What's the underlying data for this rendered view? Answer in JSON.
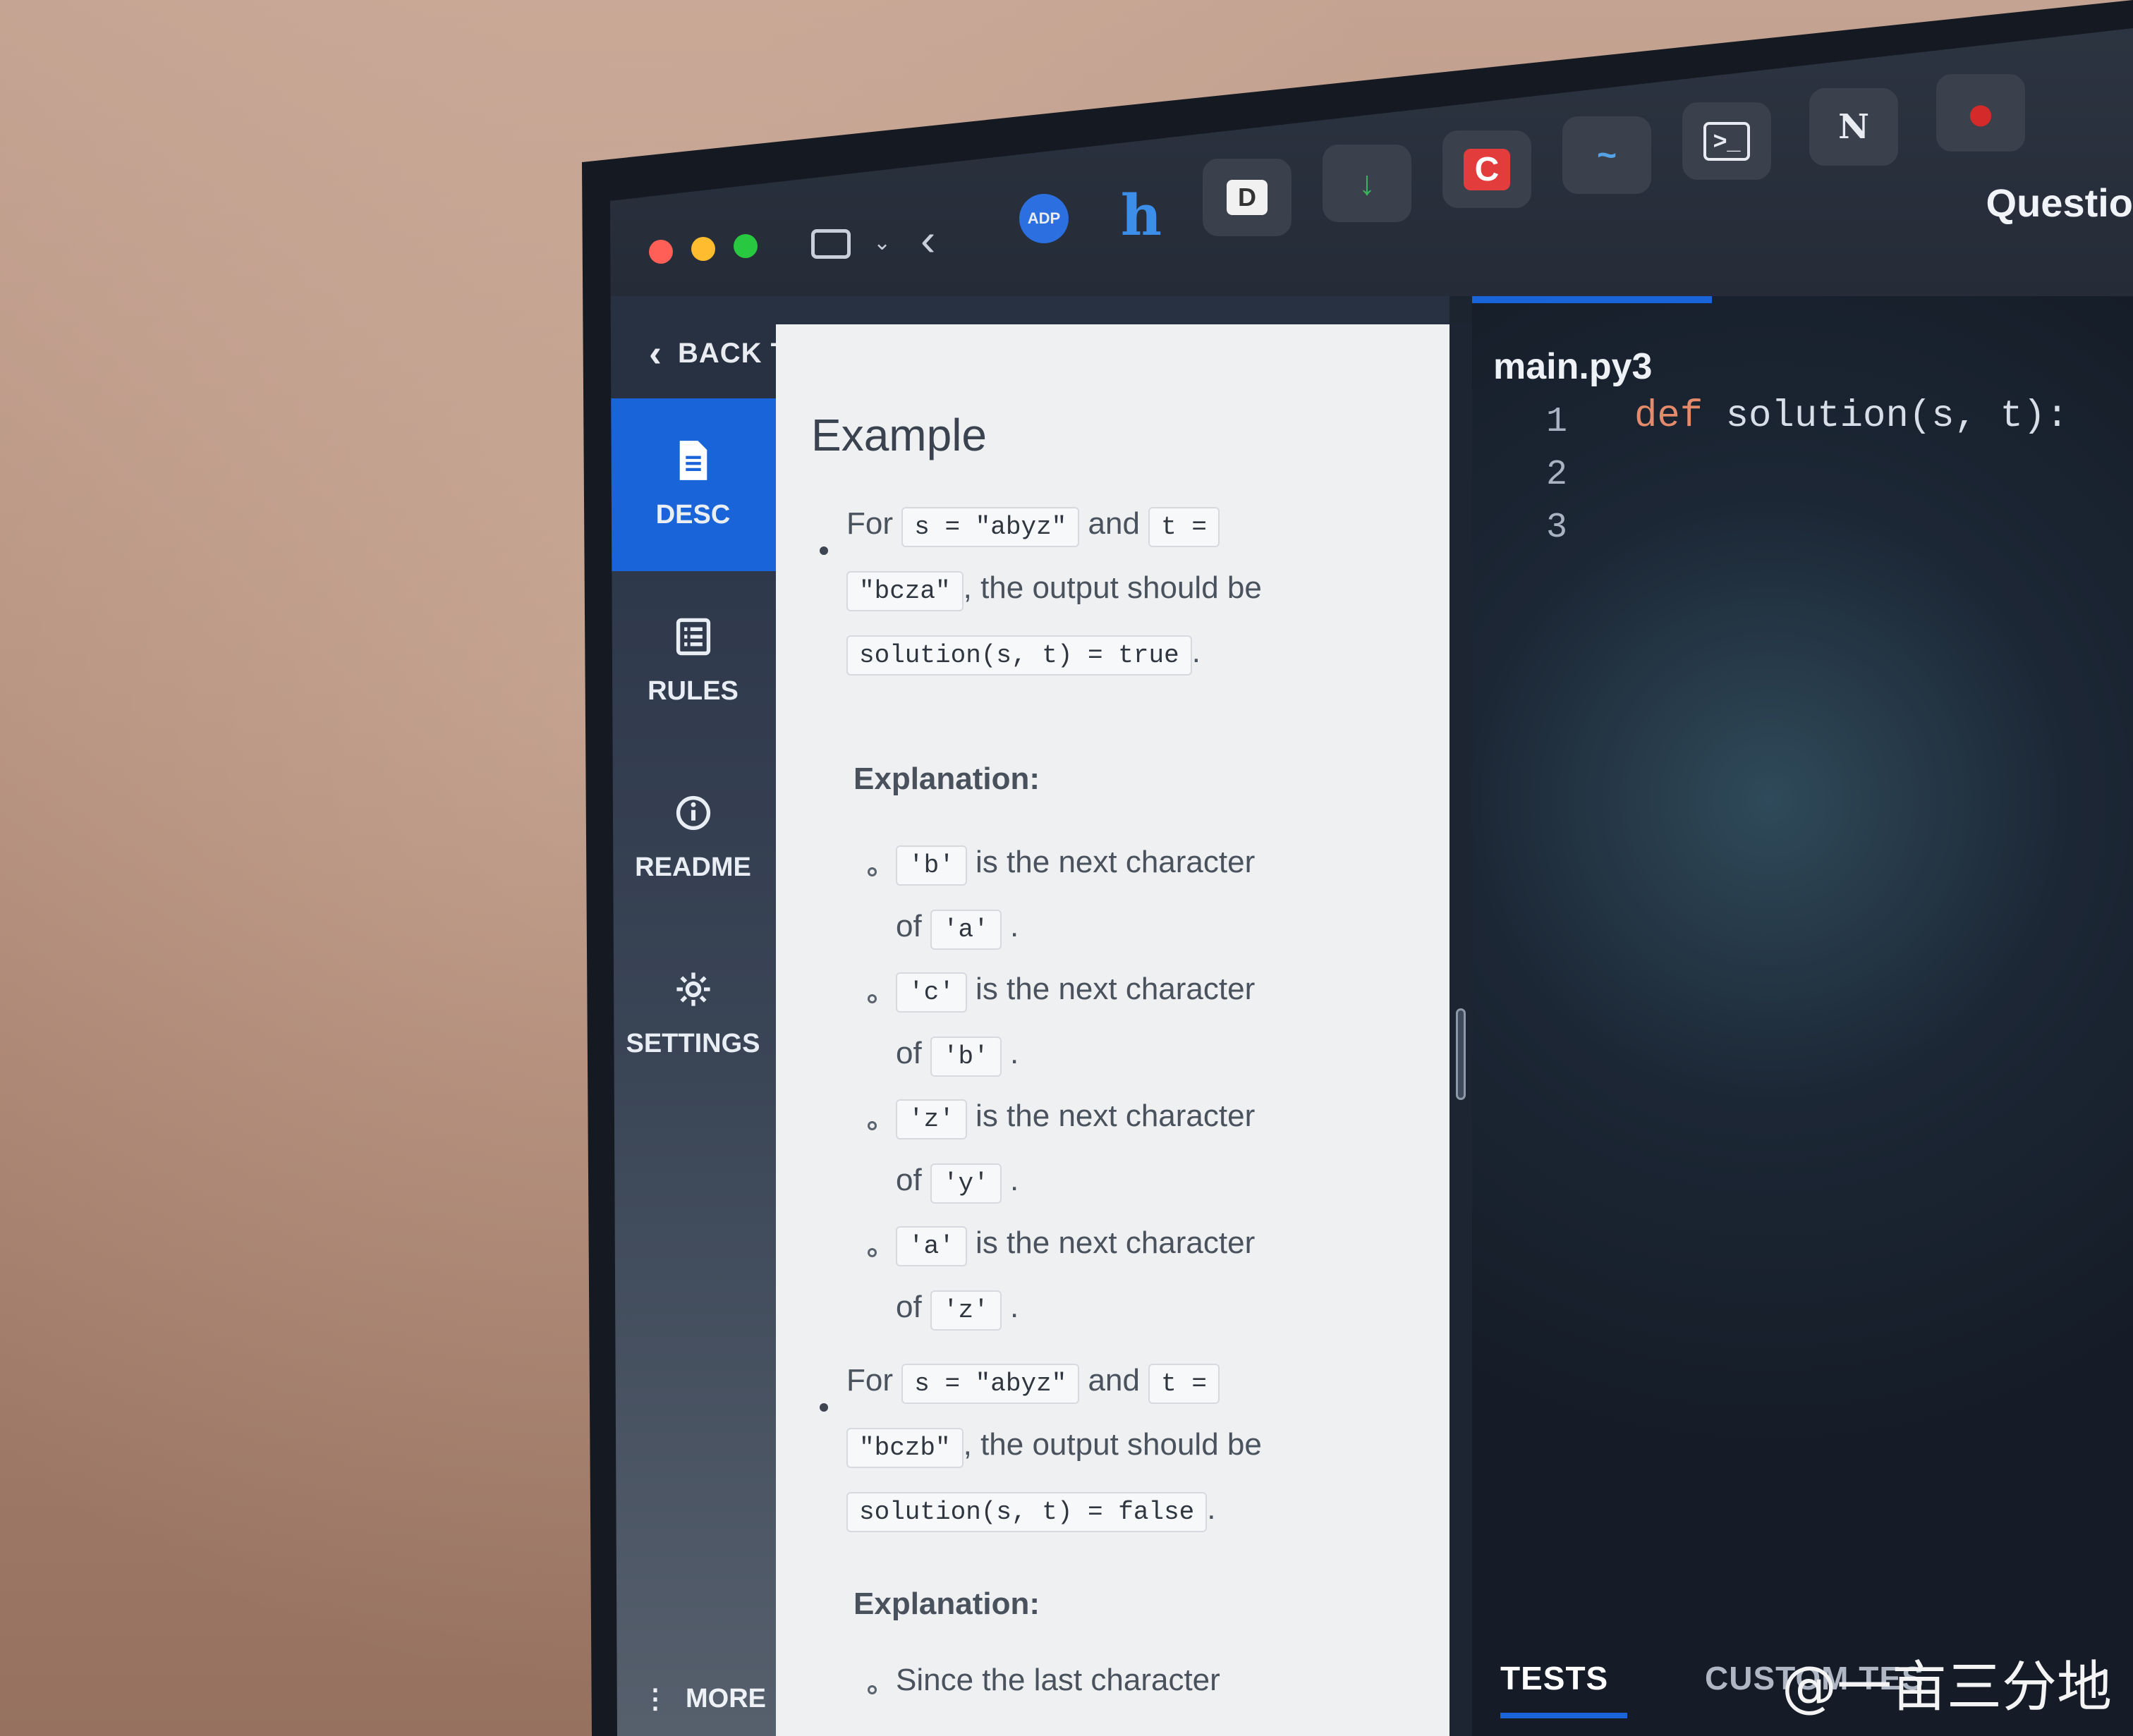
{
  "window": {
    "title": "Questio",
    "traffic_lights": {
      "close": "#ff5f57",
      "minimize": "#febc2e",
      "zoom": "#28c840"
    }
  },
  "toolbar": {
    "sidebar_icon": "sidebar-toggle-icon",
    "back_icon": "chevron-left-icon",
    "apps": [
      {
        "name": "adp-app",
        "label": "ADP"
      },
      {
        "name": "h-app",
        "label": "h"
      },
      {
        "name": "d-app",
        "label": "D"
      },
      {
        "name": "download-app",
        "label": "↓"
      },
      {
        "name": "c-app",
        "label": "C"
      },
      {
        "name": "fish-app",
        "label": "~"
      },
      {
        "name": "terminal-app",
        "label": ">_"
      },
      {
        "name": "notion-app",
        "label": "N"
      },
      {
        "name": "record-app",
        "label": "●"
      }
    ]
  },
  "nav": {
    "back_label": "BACK TO QUESTIONS"
  },
  "sidebar": {
    "items": [
      {
        "label": "DESC",
        "icon": "document-icon",
        "active": true
      },
      {
        "label": "RULES",
        "icon": "list-icon",
        "active": false
      },
      {
        "label": "README",
        "icon": "info-icon",
        "active": false
      },
      {
        "label": "SETTINGS",
        "icon": "gear-icon",
        "active": false
      }
    ],
    "more_label": "MORE"
  },
  "description": {
    "heading": "Example",
    "example1": {
      "for": "For",
      "s_code": "s = \"abyz\"",
      "and": "and",
      "t_code_a": "t =",
      "t_code_b": "\"bcza\"",
      "output_text": ", the output should be",
      "result_code": "solution(s, t) = true",
      "period": "."
    },
    "explanation1_label": "Explanation:",
    "explanations1": [
      {
        "char": "'b'",
        "text": "is the next character",
        "of": "of",
        "prev": "'a'"
      },
      {
        "char": "'c'",
        "text": "is the next character",
        "of": "of",
        "prev": "'b'"
      },
      {
        "char": "'z'",
        "text": "is the next character",
        "of": "of",
        "prev": "'y'"
      },
      {
        "char": "'a'",
        "text": "is the next character",
        "of": "of",
        "prev": "'z'"
      }
    ],
    "example2": {
      "for": "For",
      "s_code": "s = \"abyz\"",
      "and": "and",
      "t_code_a": "t =",
      "t_code_b": "\"bczb\"",
      "output_text": ", the output should be",
      "result_code": "solution(s, t) = false",
      "period": "."
    },
    "explanation2_label": "Explanation:",
    "explanation2_first": "Since the last character"
  },
  "editor": {
    "file_tab": "main.py3",
    "line_numbers": [
      "1",
      "2",
      "3"
    ],
    "code_keyword": "def",
    "code_rest": " solution(s, t):"
  },
  "bottom_tabs": {
    "tests": "TESTS",
    "custom": "CUSTOM TES"
  },
  "watermark": "@一亩三分地"
}
